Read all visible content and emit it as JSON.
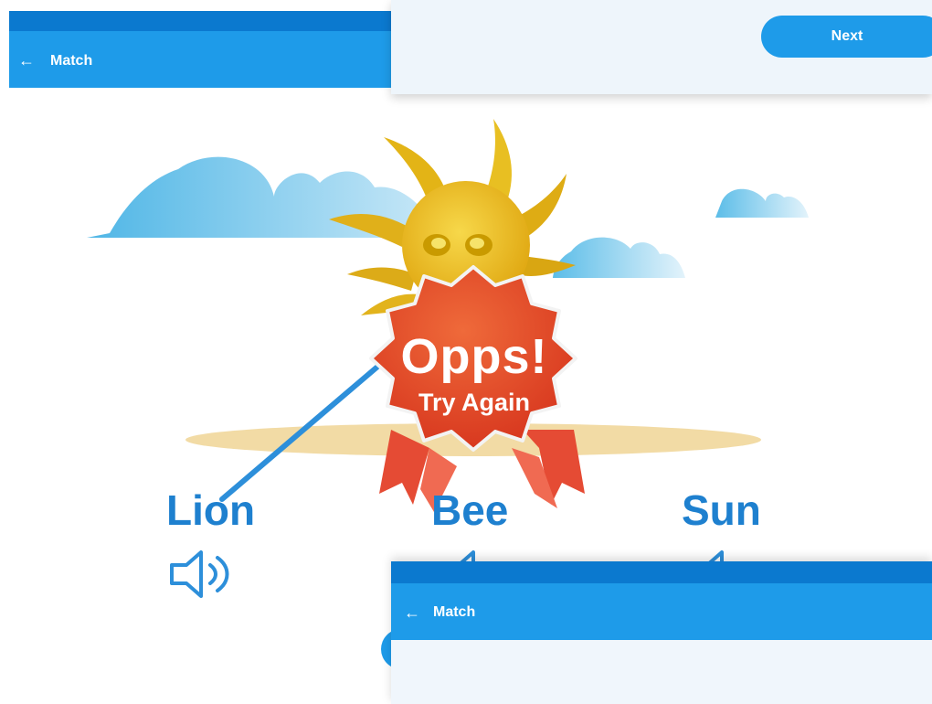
{
  "main_screen": {
    "app_bar": {
      "back_icon": "arrow-left-icon",
      "title": "Match"
    },
    "words": [
      {
        "label": "Lion",
        "speaker_icon": "speaker-icon"
      },
      {
        "label": "Bee",
        "speaker_icon": "speaker-icon"
      },
      {
        "label": "Sun",
        "speaker_icon": "speaker-icon"
      }
    ]
  },
  "top_card": {
    "next_label": "Next"
  },
  "feedback_badge": {
    "headline": "Opps!",
    "subtext": "Try Again"
  },
  "bottom_screen": {
    "app_bar": {
      "back_icon": "arrow-left-icon",
      "title": "Match"
    }
  },
  "colors": {
    "primary": "#1e9be9",
    "primary_dark": "#0b79cf",
    "word": "#1e80cf",
    "badge": "#e0452e",
    "sun": "#f0c419"
  }
}
